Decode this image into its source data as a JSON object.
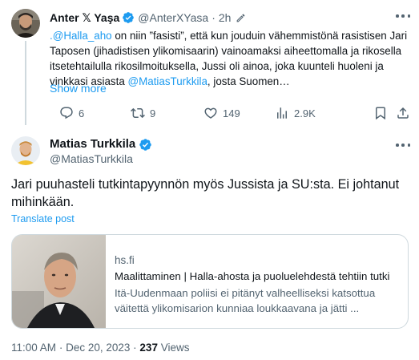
{
  "parent_tweet": {
    "author_name": "Anter 𝕏 Yaşa",
    "handle": "@AnterXYasa",
    "separator": "·",
    "time": "2h",
    "edited_icon": "pencil-icon",
    "verified_icon": "verified-badge-icon",
    "text_lines": [
      [
        {
          "t": ".@Halla_aho",
          "link": true
        },
        {
          "t": " on niin ”fasisti”, että kun jouduin vähemmistönä rasistisen Jari",
          "link": false
        }
      ],
      [
        {
          "t": "Taposen (jihadistisen ylikomisaarin) vainoamaksi aiheettomalla ja rikosella",
          "link": false
        }
      ],
      [
        {
          "t": "itsetehtailulla rikosilmoituksella, Jussi oli ainoa, joka kuunteli huoleni ja",
          "link": false
        }
      ],
      [
        {
          "t": "vinkkasi asiasta ",
          "link": false
        },
        {
          "t": "@MatiasTurkkila",
          "link": true
        },
        {
          "t": ", josta Suomen…",
          "link": false
        }
      ]
    ],
    "show_more": "Show more",
    "actions": {
      "reply": {
        "count": "6",
        "icon": "reply-icon"
      },
      "retweet": {
        "count": "9",
        "icon": "retweet-icon"
      },
      "like": {
        "count": "149",
        "icon": "heart-icon"
      },
      "views": {
        "count": "2.9K",
        "icon": "analytics-icon"
      },
      "bookmark": {
        "icon": "bookmark-icon"
      },
      "share": {
        "icon": "share-icon"
      }
    }
  },
  "main_tweet": {
    "author_name": "Matias Turkkila",
    "handle": "@MatiasTurkkila",
    "verified_icon": "verified-badge-icon",
    "text_lines": [
      "Jari puuhasteli tutkintapyynnön myös Jussista ja SU:sta. Ei johtanut",
      "mihinkään."
    ],
    "translate": "Translate post",
    "card": {
      "domain": "hs.fi",
      "title": "Maalittaminen | Halla-ahosta ja puoluelehdestä tehtiin tutki",
      "description_lines": [
        "Itä-Uudenmaan poliisi ei pitänyt valheelliseksi katsottua",
        "väitettä ylikomisarion kunniaa loukkaavana ja jätti ..."
      ]
    },
    "meta": {
      "time": "11:00 AM",
      "separator": "·",
      "date": "Dec 20, 2023",
      "views_count": "237",
      "views_label": "Views"
    }
  },
  "colors": {
    "text": "#0f1419",
    "secondary": "#536471",
    "accent": "#1d9bf0",
    "border": "#cfd9de"
  }
}
